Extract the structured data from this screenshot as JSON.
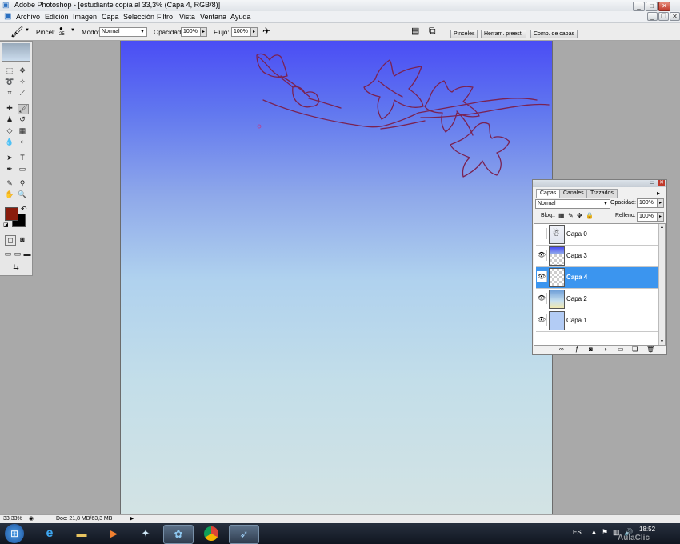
{
  "window": {
    "title": "Adobe Photoshop - [estudiante copia al 33,3% (Capa 4, RGB/8)]",
    "controls": [
      "_",
      "□",
      "✕"
    ],
    "doc_controls": [
      "_",
      "❐",
      "✕"
    ]
  },
  "menu": [
    "Archivo",
    "Edición",
    "Imagen",
    "Capa",
    "Selección",
    "Filtro",
    "Vista",
    "Ventana",
    "Ayuda"
  ],
  "options": {
    "brush_label": "Pincel:",
    "brush_size": "25",
    "mode_label": "Modo:",
    "mode_value": "Normal",
    "opacity_label": "Opacidad:",
    "opacity_value": "100%",
    "flow_label": "Flujo:",
    "flow_value": "100%",
    "well_tabs": [
      "Pinceles",
      "Herram. preest.",
      "Comp. de capas"
    ]
  },
  "tools": {
    "foreground_color": "#8a1c0c",
    "background_color": "#000000"
  },
  "layers_panel": {
    "tabs": [
      "Capas",
      "Canales",
      "Trazados"
    ],
    "blend_mode": "Normal",
    "opacity_label": "Opacidad:",
    "opacity_value": "100%",
    "lock_label": "Bloq.:",
    "fill_label": "Relleno:",
    "fill_value": "100%",
    "layers": [
      {
        "name": "Capa 0",
        "visible": false,
        "selected": false
      },
      {
        "name": "Capa 3",
        "visible": true,
        "selected": false
      },
      {
        "name": "Capa 4",
        "visible": true,
        "selected": true
      },
      {
        "name": "Capa 2",
        "visible": true,
        "selected": false
      },
      {
        "name": "Capa 1",
        "visible": true,
        "selected": false
      }
    ]
  },
  "status": {
    "zoom": "33,33%",
    "doc_info": "Doc: 21,8 MB/63,3 MB"
  },
  "taskbar": {
    "language": "ES",
    "time": "18:52",
    "watermark": "AulaClic"
  }
}
